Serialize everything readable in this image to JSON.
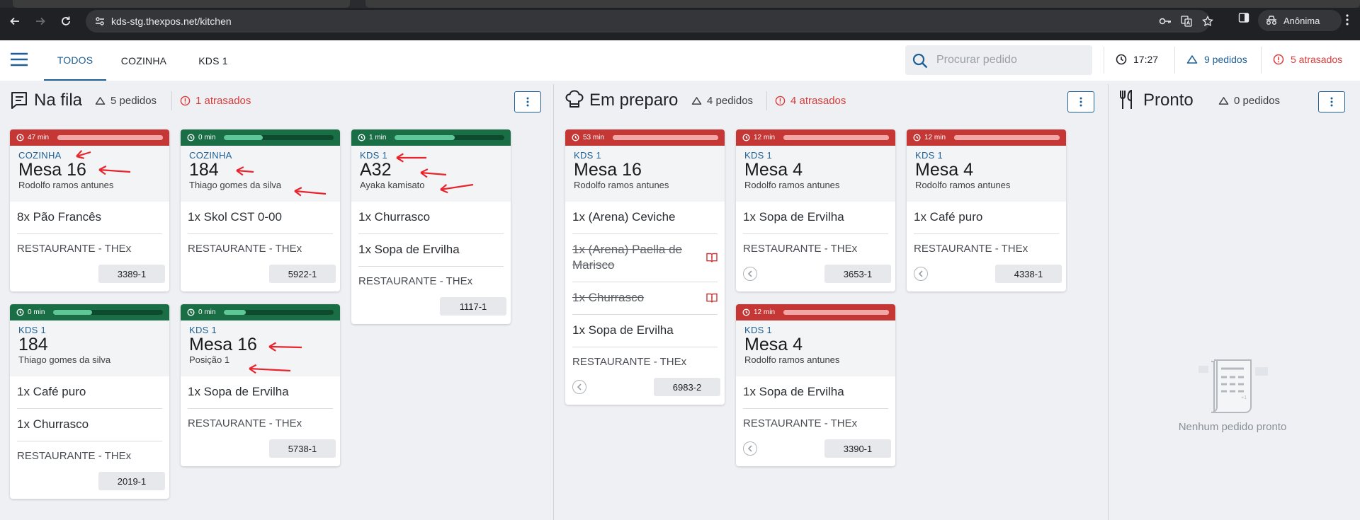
{
  "browser": {
    "url": "kds-stg.thexpos.net/kitchen",
    "profile_label": "Anônima"
  },
  "header": {
    "tabs": [
      {
        "label": "TODOS",
        "active": true
      },
      {
        "label": "COZINHA",
        "active": false
      },
      {
        "label": "KDS 1",
        "active": false
      }
    ],
    "search_placeholder": "Procurar pedido",
    "clock": "17:27",
    "orders_count": "9 pedidos",
    "late_count": "5 atrasados"
  },
  "colors": {
    "accent": "#1d5f94",
    "late": "#d93b39",
    "timer_green": "#1a6e45",
    "timer_red": "#c53735"
  },
  "columns": {
    "queue": {
      "title": "Na fila",
      "orders": "5 pedidos",
      "late": "1 atrasados"
    },
    "prep": {
      "title": "Em preparo",
      "orders": "4 pedidos",
      "late": "4 atrasados"
    },
    "ready": {
      "title": "Pronto",
      "orders": "0 pedidos",
      "empty_message": "Nenhum pedido pronto"
    }
  },
  "cards": {
    "q1": {
      "time": "47 min",
      "status": "late",
      "progress": 1.0,
      "station": "COZINHA",
      "name": "Mesa 16",
      "customer": "Rodolfo ramos antunes",
      "items": [
        "8x Pão Francês"
      ],
      "restaurant": "RESTAURANTE - THEx",
      "code": "3389-1"
    },
    "q2": {
      "time": "0 min",
      "status": "ok",
      "progress": 0.35,
      "station": "COZINHA",
      "name": "184",
      "customer": "Thiago gomes da silva",
      "items": [
        "1x Skol CST 0-00"
      ],
      "restaurant": "RESTAURANTE - THEx",
      "code": "5922-1"
    },
    "q3": {
      "time": "1 min",
      "status": "ok",
      "progress": 0.55,
      "station": "KDS 1",
      "name": "A32",
      "customer": "Ayaka kamisato",
      "items": [
        "1x Churrasco",
        "1x Sopa de Ervilha"
      ],
      "restaurant": "RESTAURANTE - THEx",
      "code": "1117-1"
    },
    "q4": {
      "time": "0 min",
      "status": "ok",
      "progress": 0.35,
      "station": "KDS 1",
      "name": "184",
      "customer": "Thiago gomes da silva",
      "items": [
        "1x Café puro",
        "1x Churrasco"
      ],
      "restaurant": "RESTAURANTE - THEx",
      "code": "2019-1"
    },
    "q5": {
      "time": "0 min",
      "status": "ok",
      "progress": 0.2,
      "station": "KDS 1",
      "name": "Mesa 16",
      "customer": "Posição 1",
      "items": [
        "1x Sopa de Ervilha"
      ],
      "restaurant": "RESTAURANTE - THEx",
      "code": "5738-1"
    },
    "p1": {
      "time": "53 min",
      "status": "late",
      "progress": 1.0,
      "station": "KDS 1",
      "name": "Mesa 16",
      "customer": "Rodolfo ramos antunes",
      "items": [
        "1x (Arena) Ceviche",
        "1x (Arena) Paella de Marisco",
        "1x Churrasco",
        "1x Sopa de Ervilha"
      ],
      "struck_items": [
        false,
        true,
        true,
        false
      ],
      "restaurant": "RESTAURANTE - THEx",
      "code": "6983-2"
    },
    "p2": {
      "time": "12 min",
      "status": "late",
      "progress": 1.0,
      "station": "KDS 1",
      "name": "Mesa 4",
      "customer": "Rodolfo ramos antunes",
      "items": [
        "1x Sopa de Ervilha"
      ],
      "restaurant": "RESTAURANTE - THEx",
      "code": "3653-1"
    },
    "p3": {
      "time": "12 min",
      "status": "late",
      "progress": 1.0,
      "station": "KDS 1",
      "name": "Mesa 4",
      "customer": "Rodolfo ramos antunes",
      "items": [
        "1x Café puro"
      ],
      "restaurant": "RESTAURANTE - THEx",
      "code": "4338-1"
    },
    "p4": {
      "time": "12 min",
      "status": "late",
      "progress": 1.0,
      "station": "KDS 1",
      "name": "Mesa 4",
      "customer": "Rodolfo ramos antunes",
      "items": [
        "1x Sopa de Ervilha"
      ],
      "restaurant": "RESTAURANTE - THEx",
      "code": "3390-1"
    }
  }
}
